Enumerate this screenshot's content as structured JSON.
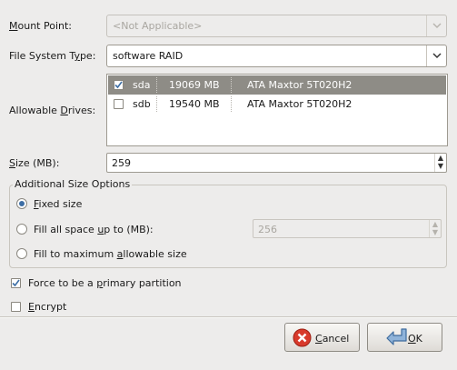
{
  "mount_point": {
    "label": "Mount Point:",
    "value": "<Not Applicable>"
  },
  "fs_type": {
    "label": "File System Type:",
    "value": "software RAID"
  },
  "drives": {
    "label": "Allowable Drives:",
    "rows": [
      {
        "checked": true,
        "name": "sda",
        "size": "19069 MB",
        "model": "ATA Maxtor 5T020H2",
        "selected": true
      },
      {
        "checked": false,
        "name": "sdb",
        "size": "19540 MB",
        "model": "ATA Maxtor 5T020H2",
        "selected": false
      }
    ]
  },
  "size": {
    "label": "Size (MB):",
    "value": "259"
  },
  "size_options": {
    "title": "Additional Size Options",
    "fixed": "Fixed size",
    "fill_up_to": "Fill all space up to (MB):",
    "fill_up_to_value": "256",
    "fill_max": "Fill to maximum allowable size",
    "selected": "fixed"
  },
  "primary": {
    "label": "Force to be a primary partition",
    "checked": true
  },
  "encrypt": {
    "label": "Encrypt",
    "checked": false
  },
  "buttons": {
    "cancel": "Cancel",
    "ok": "OK"
  },
  "colors": {
    "selection": "#8e8c86",
    "check_accent": "#3d6ea5",
    "cancel_icon": "#d83a2b"
  }
}
